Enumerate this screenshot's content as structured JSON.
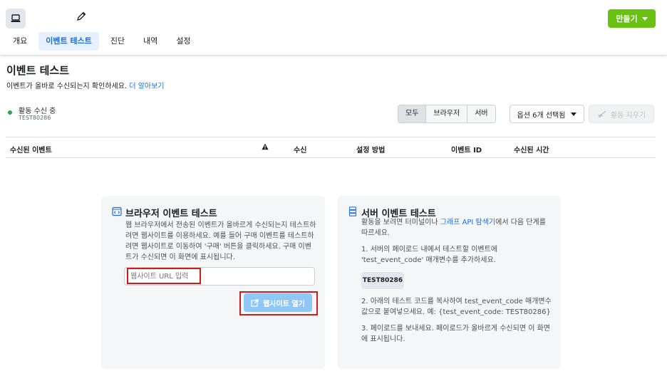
{
  "header": {
    "create_label": "만들기",
    "tabs": [
      "개요",
      "이벤트 테스트",
      "진단",
      "내역",
      "설정"
    ],
    "active_tab": "이벤트 테스트"
  },
  "page": {
    "title": "이벤트 테스트",
    "description": "이벤트가 올바로 수신되는지 확인하세요.",
    "learn_more": "더 알아보기"
  },
  "status": {
    "label": "활동 수신 중",
    "code": "TEST80286"
  },
  "filters": {
    "segments": [
      "모두",
      "브라우저",
      "서버"
    ],
    "active_segment": "모두",
    "options_label": "옵션 6개 선택됨",
    "clear_label": "활동 지우기"
  },
  "table": {
    "columns": [
      "수신된 이벤트",
      "수신",
      "설정 방법",
      "이벤트 ID",
      "수신된 시간"
    ]
  },
  "browser_card": {
    "title": "브라우저 이벤트 테스트",
    "description": "웹 브라우저에서 전송된 이벤트가 올바르게 수신되는지 테스트하려면 웹사이트를 이용하세요. 예를 들어 구매 이벤트를 테스트하려면 웹사이트로 이동하여 '구매' 버튼을 클릭하세요. 구매 이벤트가 수신되면 이 화면에 표시됩니다.",
    "url_placeholder": "웹사이트 URL 입력",
    "open_label": "웹사이트 열기"
  },
  "server_card": {
    "title": "서버 이벤트 테스트",
    "intro_prefix": "활동을 보려면 터미널이나 ",
    "intro_link": "그래프 API 탐색기",
    "intro_suffix": "에서 다음 단계를 따르세요.",
    "step1": "1. 서버의 페이로드 내에서 테스트할 이벤트에 'test_event_code' 매개변수를 추가하세요.",
    "code": "TEST80286",
    "step2": "2. 아래의 테스트 코드를 복사하여 test_event_code 매개변수 값으로 붙여넣으세요. 예: {test_event_code: TEST80286}",
    "step3": "3. 페이로드를 보내세요. 페이로드가 올바르게 수신되면 이 화면에 표시됩니다."
  },
  "colors": {
    "accent": "#69c211",
    "tab_active": "#1a6ed8",
    "highlight": "#d11a1a"
  }
}
